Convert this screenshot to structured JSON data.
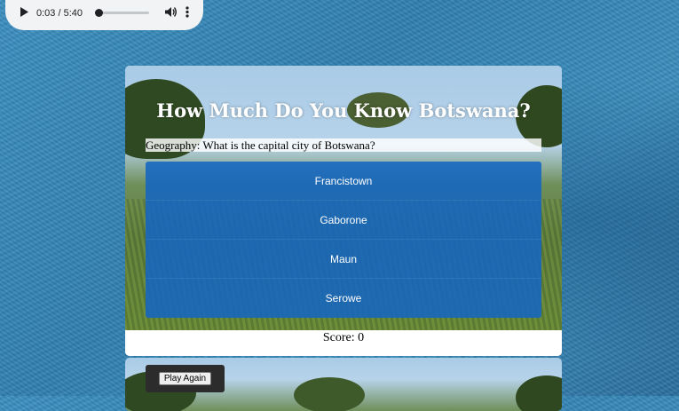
{
  "audio": {
    "time": "0:03 / 5:40",
    "progress": 0.009
  },
  "quiz": {
    "title": "How Much Do You Know Botswana?",
    "question": "Geography: What is the capital city of Botswana?",
    "answers": [
      "Francistown",
      "Gaborone",
      "Maun",
      "Serowe"
    ],
    "score_text": "Score: 0"
  },
  "controls": {
    "play_again": "Play Again"
  },
  "colors": {
    "answer_bg": "#1565c0",
    "page_bg": "#3589bb"
  }
}
